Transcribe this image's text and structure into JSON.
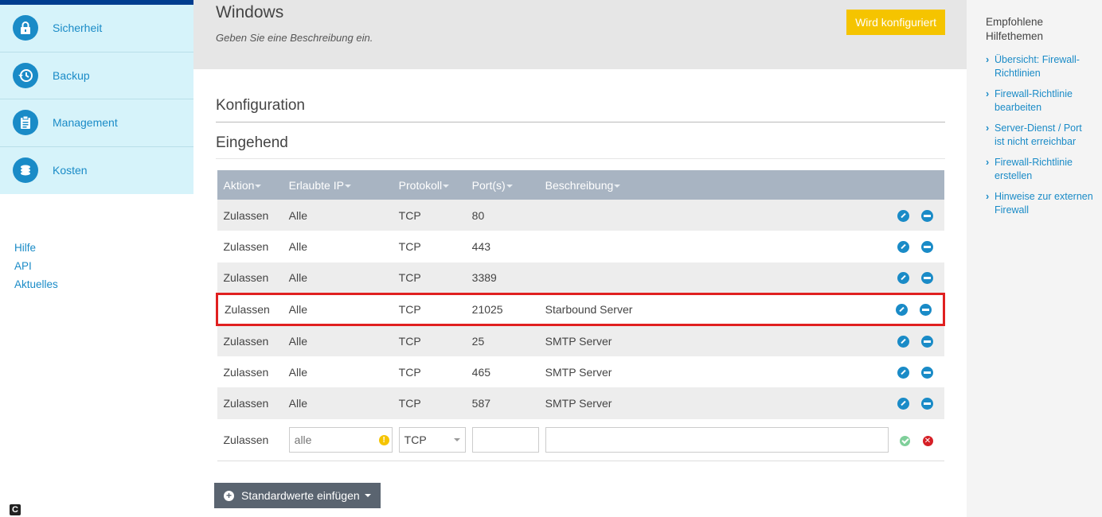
{
  "sidebar": {
    "nav": [
      {
        "label": "Sicherheit",
        "icon": "lock-icon"
      },
      {
        "label": "Backup",
        "icon": "history-icon"
      },
      {
        "label": "Management",
        "icon": "clipboard-icon"
      },
      {
        "label": "Kosten",
        "icon": "coins-icon"
      }
    ],
    "links": [
      "Hilfe",
      "API",
      "Aktuelles"
    ],
    "logo_letter": "C"
  },
  "header": {
    "title": "Windows",
    "description": "Geben Sie eine Beschreibung ein.",
    "status_button": "Wird konfiguriert"
  },
  "config": {
    "title": "Konfiguration",
    "subtitle": "Eingehend",
    "columns": [
      "Aktion",
      "Erlaubte IP",
      "Protokoll",
      "Port(s)",
      "Beschreibung"
    ],
    "rows": [
      {
        "action": "Zulassen",
        "ip": "Alle",
        "protocol": "TCP",
        "port": "80",
        "description": ""
      },
      {
        "action": "Zulassen",
        "ip": "Alle",
        "protocol": "TCP",
        "port": "443",
        "description": ""
      },
      {
        "action": "Zulassen",
        "ip": "Alle",
        "protocol": "TCP",
        "port": "3389",
        "description": ""
      },
      {
        "action": "Zulassen",
        "ip": "Alle",
        "protocol": "TCP",
        "port": "21025",
        "description": "Starbound Server"
      },
      {
        "action": "Zulassen",
        "ip": "Alle",
        "protocol": "TCP",
        "port": "25",
        "description": "SMTP Server"
      },
      {
        "action": "Zulassen",
        "ip": "Alle",
        "protocol": "TCP",
        "port": "465",
        "description": "SMTP Server"
      },
      {
        "action": "Zulassen",
        "ip": "Alle",
        "protocol": "TCP",
        "port": "587",
        "description": "SMTP Server"
      }
    ],
    "new_row": {
      "action": "Zulassen",
      "ip_placeholder": "alle",
      "protocol": "TCP",
      "port": "",
      "description": ""
    },
    "defaults_button": "Standardwerte einfügen"
  },
  "help": {
    "title": "Empfohlene Hilfethemen",
    "links": [
      "Übersicht: Firewall-Richtlinien",
      "Firewall-Richtlinie bearbeiten",
      "Server-Dienst / Port ist nicht erreichbar",
      "Firewall-Richtlinie erstellen",
      "Hinweise zur externen Firewall"
    ]
  },
  "colors": {
    "accent": "#1a8bc7",
    "status_yellow": "#f5c400",
    "highlight_red": "#e02020",
    "table_header": "#a8b4c2"
  }
}
